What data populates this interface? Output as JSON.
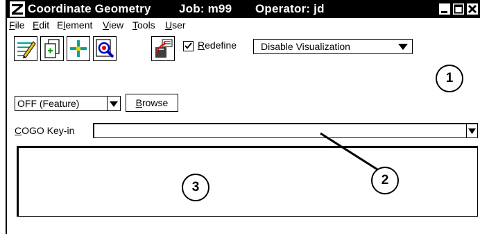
{
  "window": {
    "title": "Coordinate Geometry",
    "job": "Job: m99",
    "operator": "Operator: jd"
  },
  "menu": [
    {
      "label": "File",
      "mnemonic": "F"
    },
    {
      "label": "Edit",
      "mnemonic": "E"
    },
    {
      "label": "Element",
      "mnemonic": "l"
    },
    {
      "label": "View",
      "mnemonic": "V"
    },
    {
      "label": "Tools",
      "mnemonic": "T"
    },
    {
      "label": "User",
      "mnemonic": "U"
    }
  ],
  "toolbar": {
    "tool_icons": [
      "edit-list-icon",
      "copy-document-icon",
      "crosshair-icon",
      "zoom-inspect-icon",
      "export-icon"
    ],
    "redefine_checked": true,
    "redefine_label": "Redefine",
    "visualization_selected": "Disable Visualization",
    "feature_selected": "OFF (Feature)",
    "browse_label": "Browse"
  },
  "keyin": {
    "label": "COGO Key-in",
    "value": ""
  },
  "callouts": [
    "1",
    "2",
    "3"
  ],
  "colors": {
    "titlebar": "#000000",
    "title_text": "#ffffff"
  }
}
